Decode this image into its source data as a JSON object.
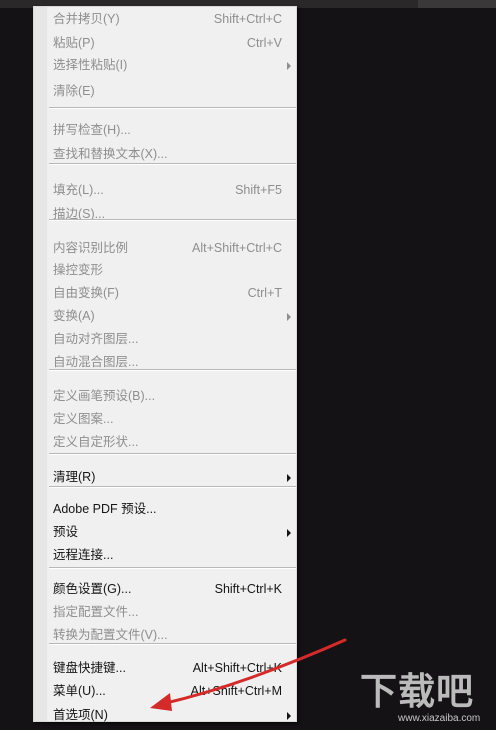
{
  "menu": {
    "items": [
      {
        "label": "合并拷贝(Y)",
        "shortcut": "Shift+Ctrl+C",
        "enabled": false,
        "submenu": false,
        "name": "menu-item-copy-merged"
      },
      {
        "label": "粘贴(P)",
        "shortcut": "Ctrl+V",
        "enabled": false,
        "submenu": false,
        "name": "menu-item-paste"
      },
      {
        "label": "选择性粘贴(I)",
        "shortcut": "",
        "enabled": false,
        "submenu": true,
        "name": "menu-item-paste-special"
      },
      {
        "label": "清除(E)",
        "shortcut": "",
        "enabled": false,
        "submenu": false,
        "name": "menu-item-clear"
      },
      {
        "separator": true
      },
      {
        "label": "拼写检查(H)...",
        "shortcut": "",
        "enabled": false,
        "submenu": false,
        "name": "menu-item-check-spelling"
      },
      {
        "label": "查找和替换文本(X)...",
        "shortcut": "",
        "enabled": false,
        "submenu": false,
        "name": "menu-item-find-replace"
      },
      {
        "separator": true
      },
      {
        "label": "填充(L)...",
        "shortcut": "Shift+F5",
        "enabled": false,
        "submenu": false,
        "name": "menu-item-fill"
      },
      {
        "label": "描边(S)...",
        "shortcut": "",
        "enabled": false,
        "submenu": false,
        "name": "menu-item-stroke"
      },
      {
        "separator": true
      },
      {
        "label": "内容识别比例",
        "shortcut": "Alt+Shift+Ctrl+C",
        "enabled": false,
        "submenu": false,
        "name": "menu-item-content-aware-scale"
      },
      {
        "label": "操控变形",
        "shortcut": "",
        "enabled": false,
        "submenu": false,
        "name": "menu-item-puppet-warp"
      },
      {
        "label": "自由变换(F)",
        "shortcut": "Ctrl+T",
        "enabled": false,
        "submenu": false,
        "name": "menu-item-free-transform"
      },
      {
        "label": "变换(A)",
        "shortcut": "",
        "enabled": false,
        "submenu": true,
        "name": "menu-item-transform"
      },
      {
        "label": "自动对齐图层...",
        "shortcut": "",
        "enabled": false,
        "submenu": false,
        "name": "menu-item-auto-align-layers"
      },
      {
        "label": "自动混合图层...",
        "shortcut": "",
        "enabled": false,
        "submenu": false,
        "name": "menu-item-auto-blend-layers"
      },
      {
        "separator": true
      },
      {
        "label": "定义画笔预设(B)...",
        "shortcut": "",
        "enabled": false,
        "submenu": false,
        "name": "menu-item-define-brush-preset"
      },
      {
        "label": "定义图案...",
        "shortcut": "",
        "enabled": false,
        "submenu": false,
        "name": "menu-item-define-pattern"
      },
      {
        "label": "定义自定形状...",
        "shortcut": "",
        "enabled": false,
        "submenu": false,
        "name": "menu-item-define-custom-shape"
      },
      {
        "separator": true
      },
      {
        "label": "清理(R)",
        "shortcut": "",
        "enabled": true,
        "submenu": true,
        "name": "menu-item-purge"
      },
      {
        "separator": true
      },
      {
        "label": "Adobe PDF 预设...",
        "shortcut": "",
        "enabled": true,
        "submenu": false,
        "name": "menu-item-adobe-pdf-presets"
      },
      {
        "label": "预设",
        "shortcut": "",
        "enabled": true,
        "submenu": true,
        "name": "menu-item-presets"
      },
      {
        "label": "远程连接...",
        "shortcut": "",
        "enabled": true,
        "submenu": false,
        "name": "menu-item-remote-connections"
      },
      {
        "separator": true
      },
      {
        "label": "颜色设置(G)...",
        "shortcut": "Shift+Ctrl+K",
        "enabled": true,
        "submenu": false,
        "name": "menu-item-color-settings"
      },
      {
        "label": "指定配置文件...",
        "shortcut": "",
        "enabled": false,
        "submenu": false,
        "name": "menu-item-assign-profile"
      },
      {
        "label": "转换为配置文件(V)...",
        "shortcut": "",
        "enabled": false,
        "submenu": false,
        "name": "menu-item-convert-to-profile"
      },
      {
        "separator": true
      },
      {
        "label": "键盘快捷键...",
        "shortcut": "Alt+Shift+Ctrl+K",
        "enabled": true,
        "submenu": false,
        "name": "menu-item-keyboard-shortcuts"
      },
      {
        "label": "菜单(U)...",
        "shortcut": "Alt+Shift+Ctrl+M",
        "enabled": true,
        "submenu": false,
        "name": "menu-item-menus"
      },
      {
        "label": "首选项(N)",
        "shortcut": "",
        "enabled": true,
        "submenu": true,
        "name": "menu-item-preferences"
      }
    ]
  },
  "annotation": {
    "arrow_color": "#d42a2a"
  },
  "watermark": {
    "logo_text": "下载吧",
    "url": "www.xiazaiba.com"
  }
}
